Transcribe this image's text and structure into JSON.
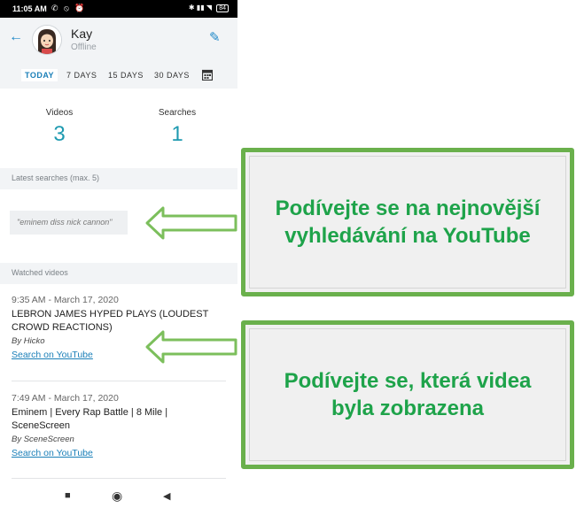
{
  "statusbar": {
    "time": "11:05 AM",
    "battery": "84"
  },
  "profile": {
    "name": "Kay",
    "status": "Offline"
  },
  "tabs": [
    {
      "label": "TODAY",
      "active": true
    },
    {
      "label": "7 DAYS",
      "active": false
    },
    {
      "label": "15 DAYS",
      "active": false
    },
    {
      "label": "30 DAYS",
      "active": false
    }
  ],
  "stats": {
    "videos_label": "Videos",
    "videos_value": "3",
    "searches_label": "Searches",
    "searches_value": "1"
  },
  "searches": {
    "section_label": "Latest searches (max. 5)",
    "items": [
      "\"eminem diss nick cannon\""
    ]
  },
  "watched": {
    "section_label": "Watched videos",
    "items": [
      {
        "time": "9:35 AM - March 17, 2020",
        "title": "LEBRON JAMES HYPED PLAYS (LOUDEST CROWD REACTIONS)",
        "by": "By Hicko",
        "link": "Search on YouTube"
      },
      {
        "time": "7:49 AM - March 17, 2020",
        "title": "Eminem | Every Rap Battle | 8 Mile | SceneScreen",
        "by": "By SceneScreen",
        "link": "Search on YouTube"
      }
    ]
  },
  "callouts": {
    "searches": "Podívejte se na nejnovější vyhledávání na YouTube",
    "videos": "Podívejte se, která videa byla zobrazena"
  },
  "colors": {
    "accent": "#1e88c8",
    "value": "#1e9ab0",
    "callout_border": "#6ab04c",
    "callout_text": "#1ea34a"
  },
  "icons": [
    "back-arrow-icon",
    "edit-pencil-icon",
    "calendar-icon",
    "arrow-left-icon"
  ]
}
